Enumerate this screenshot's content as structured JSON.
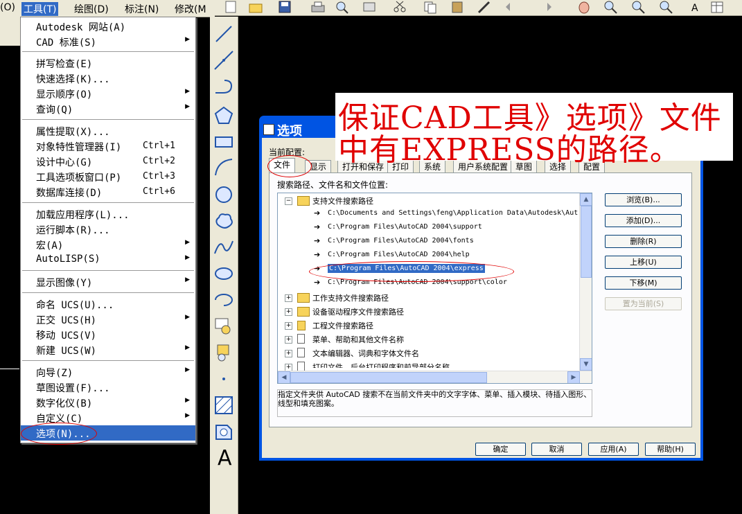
{
  "menubar": {
    "items": [
      {
        "label": "(O)"
      },
      {
        "label": "工具(T)"
      },
      {
        "label": "绘图(D)"
      },
      {
        "label": "标注(N)"
      },
      {
        "label": "修改(M"
      }
    ]
  },
  "tools_menu": {
    "items": [
      {
        "label": "Autodesk 网站(A)",
        "shortcut": "",
        "submenu": false
      },
      {
        "label": "CAD 标准(S)",
        "shortcut": "",
        "submenu": true
      },
      {
        "label": "拼写检查(E)",
        "shortcut": "",
        "submenu": false
      },
      {
        "label": "快速选择(K)...",
        "shortcut": "",
        "submenu": false
      },
      {
        "label": "显示顺序(O)",
        "shortcut": "",
        "submenu": true
      },
      {
        "label": "查询(Q)",
        "shortcut": "",
        "submenu": true
      },
      {
        "label": "属性提取(X)...",
        "shortcut": "",
        "submenu": false
      },
      {
        "label": "对象特性管理器(I)",
        "shortcut": "Ctrl+1",
        "submenu": false
      },
      {
        "label": "设计中心(G)",
        "shortcut": "Ctrl+2",
        "submenu": false
      },
      {
        "label": "工具选项板窗口(P)",
        "shortcut": "Ctrl+3",
        "submenu": false
      },
      {
        "label": "数据库连接(D)",
        "shortcut": "Ctrl+6",
        "submenu": false
      },
      {
        "label": "加载应用程序(L)...",
        "shortcut": "",
        "submenu": false
      },
      {
        "label": "运行脚本(R)...",
        "shortcut": "",
        "submenu": false
      },
      {
        "label": "宏(A)",
        "shortcut": "",
        "submenu": true
      },
      {
        "label": "AutoLISP(S)",
        "shortcut": "",
        "submenu": true
      },
      {
        "label": "显示图像(Y)",
        "shortcut": "",
        "submenu": true
      },
      {
        "label": "命名 UCS(U)...",
        "shortcut": "",
        "submenu": false
      },
      {
        "label": "正交 UCS(H)",
        "shortcut": "",
        "submenu": true
      },
      {
        "label": "移动 UCS(V)",
        "shortcut": "",
        "submenu": false
      },
      {
        "label": "新建 UCS(W)",
        "shortcut": "",
        "submenu": true
      },
      {
        "label": "向导(Z)",
        "shortcut": "",
        "submenu": true
      },
      {
        "label": "草图设置(F)...",
        "shortcut": "",
        "submenu": false
      },
      {
        "label": "数字化仪(B)",
        "shortcut": "",
        "submenu": true
      },
      {
        "label": "自定义(C)",
        "shortcut": "",
        "submenu": true
      },
      {
        "label": "选项(N)...",
        "shortcut": "",
        "submenu": false,
        "selected": true
      }
    ]
  },
  "banner": {
    "line1": "保证CAD工具》选项》文件",
    "line2": "中有EXPRESS的路径。"
  },
  "dialog": {
    "title": "选项",
    "current_profile_label": "当前配置:",
    "tabs": [
      "文件",
      "显示",
      "打开和保存",
      "打印",
      "系统",
      "用户系统配置",
      "草图",
      "选择",
      "配置"
    ],
    "active_tab": "文件",
    "section_label": "搜索路径、文件名和文件位置:",
    "tree": {
      "root": "支持文件搜索路径",
      "paths": [
        "C:\\Documents and Settings\\feng\\Application Data\\Autodesk\\Aut",
        "C:\\Program Files\\AutoCAD 2004\\support",
        "C:\\Program Files\\AutoCAD 2004\\fonts",
        "C:\\Program Files\\AutoCAD 2004\\help",
        "C:\\Program Files\\AutoCAD 2004\\express",
        "C:\\Program Files\\AutoCAD 2004\\support\\color"
      ],
      "selected_path": "C:\\Program Files\\AutoCAD 2004\\express",
      "groups": [
        "工作支持文件搜索路径",
        "设备驱动程序文件搜索路径",
        "工程文件搜索路径",
        "菜单、帮助和其他文件名称",
        "文本编辑器、词典和字体文件名",
        "打印文件、后台打印程序和前导部分名称"
      ]
    },
    "side_buttons": [
      {
        "label": "浏览(B)...",
        "enabled": true
      },
      {
        "label": "添加(D)...",
        "enabled": true
      },
      {
        "label": "删除(R)",
        "enabled": true
      },
      {
        "label": "上移(U)",
        "enabled": true
      },
      {
        "label": "下移(M)",
        "enabled": true
      },
      {
        "label": "置为当前(S)",
        "enabled": false
      }
    ],
    "description": "指定文件夹供 AutoCAD 搜索不在当前文件夹中的文字字体、菜单、插入模块、待插入图形、线型和填充图案。",
    "bottom_buttons": [
      "确定",
      "取消",
      "应用(A)",
      "帮助(H)"
    ]
  },
  "draw_toolbar": {
    "tools": [
      "line-icon",
      "construction-line-icon",
      "polyline-icon",
      "polygon-icon",
      "rectangle-icon",
      "arc-icon",
      "circle-icon",
      "revision-cloud-icon",
      "spline-icon",
      "ellipse-icon",
      "ellipse-arc-icon",
      "insert-block-icon",
      "make-block-icon",
      "point-icon",
      "hatch-icon",
      "region-icon",
      "multiline-text-icon"
    ],
    "text_tool_glyph": "A"
  },
  "colors": {
    "menu_highlight": "#316ac5",
    "dialog_title": "#0054e3",
    "annotation_red": "#e00000"
  }
}
